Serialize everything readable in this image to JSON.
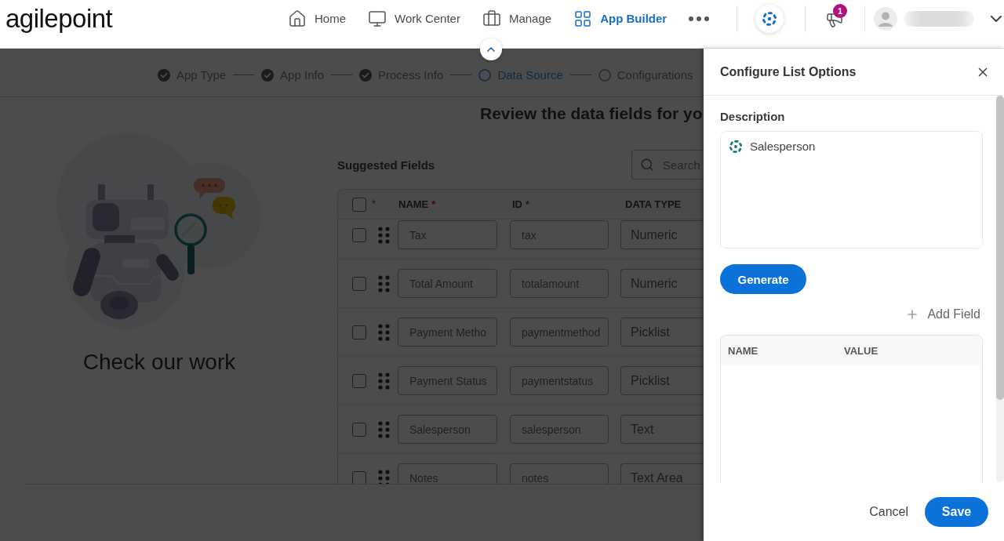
{
  "header": {
    "logo": "agilepoint",
    "nav": [
      {
        "label": "Home",
        "selected": false
      },
      {
        "label": "Work Center",
        "selected": false
      },
      {
        "label": "Manage",
        "selected": false
      },
      {
        "label": "App Builder",
        "selected": true
      }
    ],
    "notifications": {
      "badge": "1"
    }
  },
  "stepper": {
    "steps": [
      {
        "label": "App Type",
        "completed": true,
        "selected": false
      },
      {
        "label": "App Info",
        "completed": true,
        "selected": false
      },
      {
        "label": "Process Info",
        "completed": true,
        "selected": false
      },
      {
        "label": "Data Source",
        "completed": false,
        "selected": true
      },
      {
        "label": "Configurations",
        "completed": false,
        "selected": false
      }
    ]
  },
  "page": {
    "heading": "Review the data fields for yo",
    "illustration_caption": "Check our work",
    "suggested_fields": {
      "title": "Suggested Fields",
      "search": {
        "placeholder": "Search"
      },
      "table": {
        "select_all": {
          "checked": false,
          "required_mark": "*"
        },
        "columns": [
          {
            "label": "NAME",
            "required_mark": "*"
          },
          {
            "label": "ID",
            "required_mark": "*"
          },
          {
            "label": "DATA TYPE"
          }
        ],
        "rows": [
          {
            "checked": false,
            "name": "Tax",
            "id": "tax",
            "data_type": "Numeric"
          },
          {
            "checked": false,
            "name": "Total Amount",
            "id": "totalamount",
            "data_type": "Numeric"
          },
          {
            "checked": false,
            "name": "Payment Metho",
            "id": "paymentmethod",
            "data_type": "Picklist"
          },
          {
            "checked": false,
            "name": "Payment Status",
            "id": "paymentstatus",
            "data_type": "Picklist"
          },
          {
            "checked": false,
            "name": "Salesperson",
            "id": "salesperson",
            "data_type": "Text"
          },
          {
            "checked": false,
            "name": "Notes",
            "id": "notes",
            "data_type": "Text Area"
          }
        ]
      }
    }
  },
  "panel": {
    "title": "Configure List Options",
    "description": {
      "label": "Description",
      "value": "Salesperson"
    },
    "generate_button": "Generate",
    "add_field_button": "Add Field",
    "table": {
      "columns": [
        "NAME",
        "VALUE"
      ]
    },
    "buttons": [
      {
        "label": "Cancel",
        "kind": "text"
      },
      {
        "label": "Save",
        "kind": "primary"
      }
    ]
  }
}
